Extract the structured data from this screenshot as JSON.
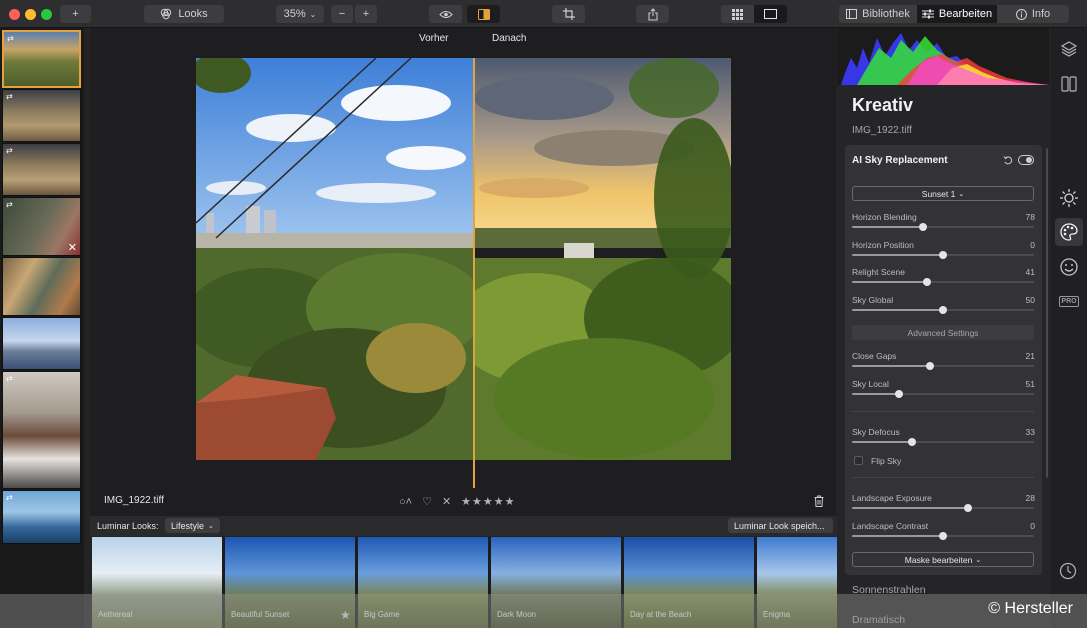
{
  "toolbar": {
    "add_label": "+",
    "looks_label": "Looks",
    "zoom_label": "35%",
    "zoom_out_label": "−",
    "zoom_in_label": "+",
    "tabs": [
      {
        "label": "Bibliothek",
        "active": false
      },
      {
        "label": "Bearbeiten",
        "active": true
      },
      {
        "label": "Info",
        "active": false
      }
    ]
  },
  "filmstrip": {
    "items": [
      {
        "selected": true,
        "has_edit_badge": true
      },
      {
        "selected": false,
        "has_edit_badge": true
      },
      {
        "selected": false,
        "has_edit_badge": true
      },
      {
        "selected": false,
        "has_edit_badge": true,
        "has_delete_mark": true
      },
      {
        "selected": false,
        "has_edit_badge": false
      },
      {
        "selected": false,
        "has_edit_badge": false
      },
      {
        "selected": false,
        "has_edit_badge": true
      },
      {
        "selected": false,
        "has_edit_badge": true
      }
    ]
  },
  "canvas": {
    "before_label": "Vorher",
    "after_label": "Danach"
  },
  "infobar": {
    "filename": "IMG_1922.tiff",
    "rating_stars": 0,
    "stars_max": 5
  },
  "looks": {
    "title": "Luminar Looks:",
    "category": "Lifestyle",
    "save_label": "Luminar Look speich...",
    "items": [
      {
        "label": "Aethereal"
      },
      {
        "label": "Beautiful Sunset"
      },
      {
        "label": "Big Game"
      },
      {
        "label": "Dark Moon"
      },
      {
        "label": "Day at the Beach"
      },
      {
        "label": "Enigma"
      }
    ]
  },
  "panel": {
    "section_title": "Kreativ",
    "filename": "IMG_1922.tiff",
    "tool": {
      "title": "AI Sky Replacement",
      "sky_select": "Sunset 1",
      "sliders_a": [
        {
          "label": "Horizon Blending",
          "value": "78",
          "fraction": 0.39
        },
        {
          "label": "Horizon Position",
          "value": "0",
          "fraction": 0.5
        },
        {
          "label": "Relight Scene",
          "value": "41",
          "fraction": 0.41
        },
        {
          "label": "Sky Global",
          "value": "50",
          "fraction": 0.5
        }
      ],
      "advanced_label": "Advanced Settings",
      "sliders_b": [
        {
          "label": "Close Gaps",
          "value": "21",
          "fraction": 0.43
        },
        {
          "label": "Sky Local",
          "value": "51",
          "fraction": 0.26
        }
      ],
      "sliders_c": [
        {
          "label": "Sky Defocus",
          "value": "33",
          "fraction": 0.33
        }
      ],
      "flip_sky_label": "Flip Sky",
      "flip_sky_checked": false,
      "sliders_d": [
        {
          "label": "Landscape Exposure",
          "value": "28",
          "fraction": 0.64
        },
        {
          "label": "Landscape Contrast",
          "value": "0",
          "fraction": 0.5
        }
      ],
      "mask_label": "Maske bearbeiten"
    },
    "below_tools": [
      "Sonnenstrahlen",
      "Dramatisch"
    ]
  },
  "watermark": "© Hersteller",
  "colors": {
    "accent": "#e3a23c",
    "panel_bg": "#252527",
    "card_bg": "#333335",
    "titlebar_bg": "#2e2e30"
  }
}
